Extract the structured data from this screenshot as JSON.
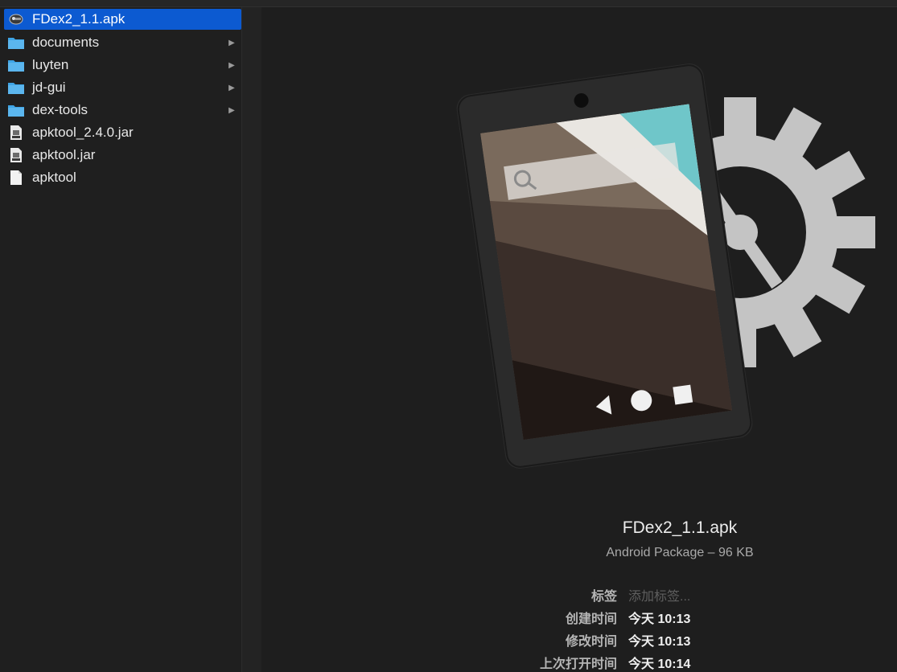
{
  "file_list": {
    "items": [
      {
        "name": "FDex2_1.1.apk",
        "icon": "apk-file-icon",
        "selected": true,
        "has_children": false
      },
      {
        "name": "documents",
        "icon": "folder-icon",
        "selected": false,
        "has_children": true
      },
      {
        "name": "luyten",
        "icon": "folder-icon",
        "selected": false,
        "has_children": true
      },
      {
        "name": "jd-gui",
        "icon": "folder-icon",
        "selected": false,
        "has_children": true
      },
      {
        "name": "dex-tools",
        "icon": "folder-icon",
        "selected": false,
        "has_children": true
      },
      {
        "name": "apktool_2.4.0.jar",
        "icon": "jar-file-icon",
        "selected": false,
        "has_children": false
      },
      {
        "name": "apktool.jar",
        "icon": "jar-file-icon",
        "selected": false,
        "has_children": false
      },
      {
        "name": "apktool",
        "icon": "document-file-icon",
        "selected": false,
        "has_children": false
      }
    ]
  },
  "preview": {
    "file_name": "FDex2_1.1.apk",
    "kind_size": "Android Package – 96 KB",
    "tags_label": "标签",
    "tags_placeholder": "添加标签...",
    "created_label": "创建时间",
    "created_value": "今天 10:13",
    "modified_label": "修改时间",
    "modified_value": "今天 10:13",
    "opened_label": "上次打开时间",
    "opened_value": "今天 10:14"
  },
  "colors": {
    "selection": "#0c5ad1",
    "folder": "#3fa5e6",
    "background": "#1e1e1e"
  }
}
